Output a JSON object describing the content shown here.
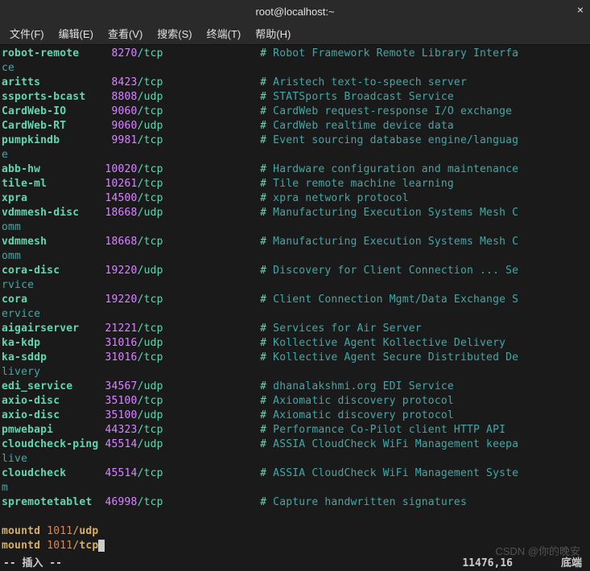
{
  "titlebar": {
    "title": "root@localhost:~",
    "close": "×"
  },
  "menubar": {
    "items": [
      "文件(F)",
      "编辑(E)",
      "查看(V)",
      "搜索(S)",
      "终端(T)",
      "帮助(H)"
    ]
  },
  "services": [
    {
      "name": "robot-remote",
      "port": "8270",
      "proto": "tcp",
      "comment": "Robot Framework Remote Library Interfa",
      "wrap": "ce"
    },
    {
      "name": "aritts",
      "port": "8423",
      "proto": "tcp",
      "comment": "Aristech text-to-speech server"
    },
    {
      "name": "ssports-bcast",
      "port": "8808",
      "proto": "udp",
      "comment": "STATSports Broadcast Service"
    },
    {
      "name": "CardWeb-IO",
      "port": "9060",
      "proto": "tcp",
      "comment": "CardWeb request-response I/O exchange"
    },
    {
      "name": "CardWeb-RT",
      "port": "9060",
      "proto": "udp",
      "comment": "CardWeb realtime device data"
    },
    {
      "name": "pumpkindb",
      "port": "9981",
      "proto": "tcp",
      "comment": "Event sourcing database engine/languag",
      "wrap": "e"
    },
    {
      "name": "abb-hw",
      "port": "10020",
      "proto": "tcp",
      "comment": "Hardware configuration and maintenance"
    },
    {
      "name": "tile-ml",
      "port": "10261",
      "proto": "tcp",
      "comment": "Tile remote machine learning"
    },
    {
      "name": "xpra",
      "port": "14500",
      "proto": "tcp",
      "comment": "xpra network protocol"
    },
    {
      "name": "vdmmesh-disc",
      "port": "18668",
      "proto": "udp",
      "comment": "Manufacturing Execution Systems Mesh C",
      "wrap": "omm"
    },
    {
      "name": "vdmmesh",
      "port": "18668",
      "proto": "tcp",
      "comment": "Manufacturing Execution Systems Mesh C",
      "wrap": "omm"
    },
    {
      "name": "cora-disc",
      "port": "19220",
      "proto": "udp",
      "comment": "Discovery for Client Connection ... Se",
      "wrap": "rvice"
    },
    {
      "name": "cora",
      "port": "19220",
      "proto": "tcp",
      "comment": "Client Connection Mgmt/Data Exchange S",
      "wrap": "ervice"
    },
    {
      "name": "aigairserver",
      "port": "21221",
      "proto": "tcp",
      "comment": "Services for Air Server"
    },
    {
      "name": "ka-kdp",
      "port": "31016",
      "proto": "udp",
      "comment": "Kollective Agent Kollective Delivery"
    },
    {
      "name": "ka-sddp",
      "port": "31016",
      "proto": "tcp",
      "comment": "Kollective Agent Secure Distributed De",
      "wrap": "livery"
    },
    {
      "name": "edi_service",
      "port": "34567",
      "proto": "udp",
      "comment": "dhanalakshmi.org EDI Service"
    },
    {
      "name": "axio-disc",
      "port": "35100",
      "proto": "tcp",
      "comment": "Axiomatic discovery protocol"
    },
    {
      "name": "axio-disc",
      "port": "35100",
      "proto": "udp",
      "comment": "Axiomatic discovery protocol"
    },
    {
      "name": "pmwebapi",
      "port": "44323",
      "proto": "tcp",
      "comment": "Performance Co-Pilot client HTTP API"
    },
    {
      "name": "cloudcheck-ping",
      "port": "45514",
      "proto": "udp",
      "comment": "ASSIA CloudCheck WiFi Management keepa",
      "wrap": "live"
    },
    {
      "name": "cloudcheck",
      "port": "45514",
      "proto": "tcp",
      "comment": "ASSIA CloudCheck WiFi Management Syste",
      "wrap": "m"
    },
    {
      "name": "spremotetablet",
      "port": "46998",
      "proto": "tcp",
      "comment": "Capture handwritten signatures"
    }
  ],
  "inserted_lines": [
    {
      "name": "mountd",
      "port": "1011",
      "proto": "udp"
    },
    {
      "name": "mountd",
      "port": "1011",
      "proto": "tcp"
    }
  ],
  "status": {
    "mode": "-- 插入 --",
    "position": "11476,16",
    "percent": "底端"
  },
  "watermark": "CSDN @你的晚安"
}
